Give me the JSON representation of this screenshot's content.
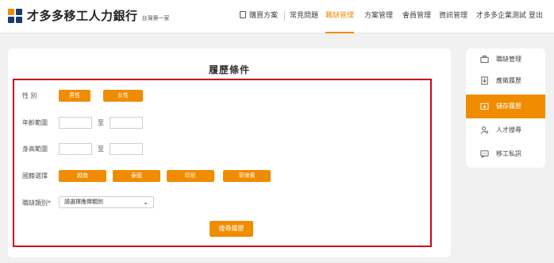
{
  "header": {
    "brand": "才多多移工人力銀行",
    "slogan": "台灣第一家",
    "nav": [
      {
        "label": "購買方案",
        "active": false
      },
      {
        "label": "常見問題",
        "active": false
      },
      {
        "label": "職缺管理",
        "active": true
      },
      {
        "label": "方案管理",
        "active": false
      },
      {
        "label": "會員管理",
        "active": false
      },
      {
        "label": "資訊管理",
        "active": false
      },
      {
        "label": "才多多企業測試",
        "active": false
      },
      {
        "label": "登出",
        "active": false
      }
    ]
  },
  "form": {
    "title": "履歷條件",
    "gender_label": "性 別",
    "gender_options": [
      "男性",
      "女性"
    ],
    "age_label": "年齡範圍",
    "age_to": "至",
    "height_label": "身高範圍",
    "height_to": "至",
    "nationality_label": "國籍選擇",
    "nationality_options": [
      "越南",
      "泰國",
      "印尼",
      "菲律賓"
    ],
    "category_label": "職缺類別*",
    "category_placeholder": "請選擇應徵類別",
    "search_button": "搜尋履歷"
  },
  "sidebar": {
    "items": [
      {
        "label": "職缺管理",
        "icon": "briefcase-icon",
        "active": false
      },
      {
        "label": "應徵履歷",
        "icon": "document-download-icon",
        "active": false
      },
      {
        "label": "儲存履歷",
        "icon": "folder-save-icon",
        "active": true
      },
      {
        "label": "人才搜尋",
        "icon": "user-search-icon",
        "active": false
      },
      {
        "label": "移工私訊",
        "icon": "chat-icon",
        "active": false
      }
    ]
  },
  "colors": {
    "accent": "#f08c00",
    "highlight_frame": "#d0021b"
  }
}
